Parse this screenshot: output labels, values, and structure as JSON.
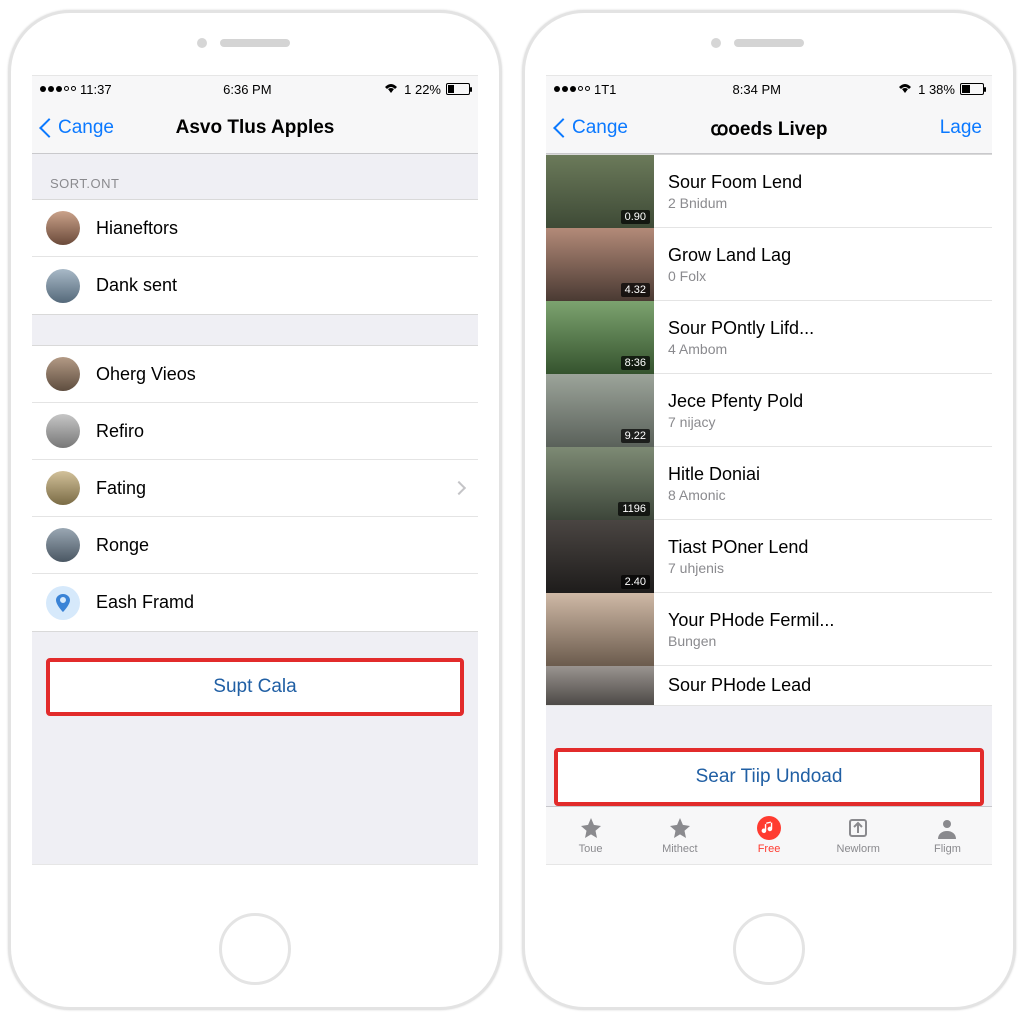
{
  "left": {
    "status": {
      "carrier": "11:37",
      "time": "6:36 PM",
      "batt": "1 22%"
    },
    "nav": {
      "back": "Cange",
      "title": "Asvo Tlus Apples"
    },
    "section_label": "SORT.ONT",
    "group1": [
      {
        "label": "Hianeftors"
      },
      {
        "label": "Dank sent"
      }
    ],
    "group2": [
      {
        "label": "Oherg Vieos",
        "chev": false
      },
      {
        "label": "Refiro",
        "chev": false
      },
      {
        "label": "Fating",
        "chev": true
      },
      {
        "label": "Ronge",
        "chev": false
      },
      {
        "label": "Eash Framd",
        "chev": false,
        "pin": true
      }
    ],
    "action": "Supt Cala"
  },
  "right": {
    "status": {
      "carrier": "1T1",
      "time": "8:34 PM",
      "batt": "1 38%"
    },
    "nav": {
      "back": "Cange",
      "title": "ꭃoeds Livep",
      "right": "Lage"
    },
    "videos": [
      {
        "title": "Sour Foom Lend",
        "sub": "2 Bnidum",
        "dur": "0.90"
      },
      {
        "title": "Grow Land Lag",
        "sub": "0 Folx",
        "dur": "4.32"
      },
      {
        "title": "Sour POntly Lifd...",
        "sub": "4 Ambom",
        "dur": "8:36"
      },
      {
        "title": "Jece Pfenty Pold",
        "sub": "7 nijacy",
        "dur": "9.22"
      },
      {
        "title": "Hitle Doniai",
        "sub": "8 Amonic",
        "dur": "1196"
      },
      {
        "title": "Tiast POner Lend",
        "sub": "7 uhjenis",
        "dur": "2.40"
      },
      {
        "title": "Your PHode Fermil...",
        "sub": "Bungen",
        "dur": ""
      },
      {
        "title": "Sour PHode Lead",
        "sub": "",
        "dur": ""
      }
    ],
    "action": "Sear Tiip Undoad",
    "tabs": [
      {
        "label": "Toue"
      },
      {
        "label": "Mithect"
      },
      {
        "label": "Free",
        "active": true
      },
      {
        "label": "Newlorm"
      },
      {
        "label": "Fligm"
      }
    ]
  }
}
